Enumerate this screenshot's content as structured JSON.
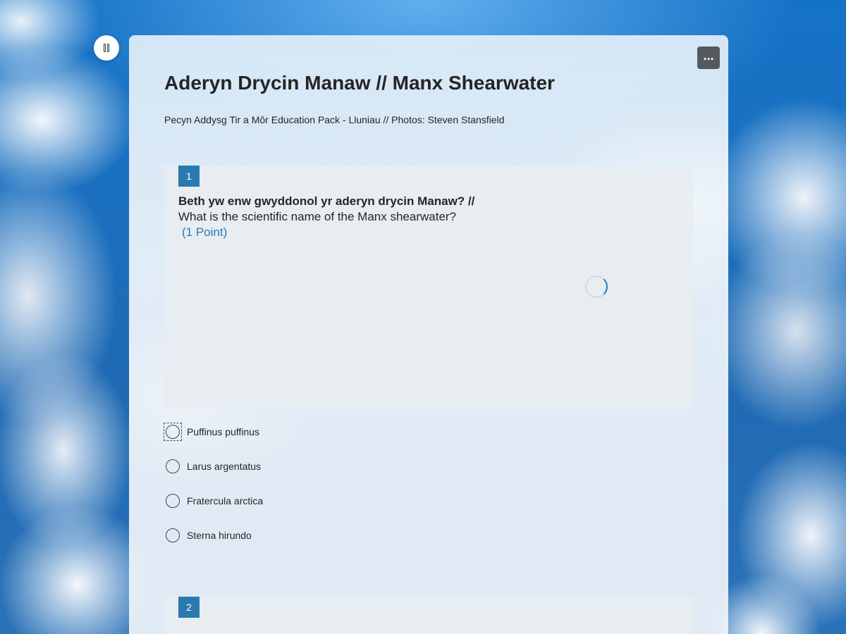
{
  "form": {
    "title": "Aderyn Drycin Manaw // Manx Shearwater",
    "subtitle": "Pecyn Addysg Tir a Môr Education Pack - Lluniau // Photos: Steven Stansfield"
  },
  "controls": {
    "pause_icon": "pause-icon",
    "more_label": "..."
  },
  "questions": [
    {
      "number": "1",
      "text_welsh": "Beth yw enw gwyddonol yr aderyn drycin Manaw? //",
      "text_english": "What is the scientific name of the Manx shearwater?",
      "points": "(1 Point)",
      "options": [
        {
          "label": "Puffinus puffinus"
        },
        {
          "label": "Larus argentatus"
        },
        {
          "label": "Fratercula arctica"
        },
        {
          "label": "Sterna hirundo"
        }
      ]
    },
    {
      "number": "2"
    }
  ],
  "colors": {
    "accent": "#2a7ab0",
    "text": "#252525",
    "more_button_bg": "#55595e"
  }
}
